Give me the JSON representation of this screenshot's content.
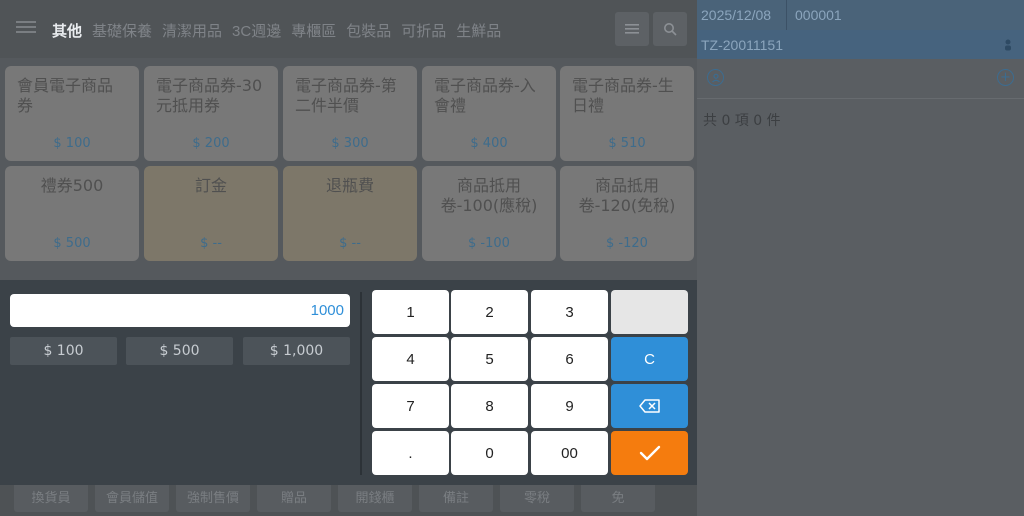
{
  "topbar": {
    "categories": [
      "其他",
      "基礎保養",
      "清潔用品",
      "3C週邊",
      "專櫃區",
      "包裝品",
      "可折品",
      "生鮮品"
    ],
    "active_category": "其他"
  },
  "products": [
    {
      "name": "會員電子商品券",
      "price": "$ 100"
    },
    {
      "name": "電子商品券-30元抵用券",
      "price": "$ 200"
    },
    {
      "name": "電子商品券-第二件半價",
      "price": "$ 300"
    },
    {
      "name": "電子商品券-入會禮",
      "price": "$ 400"
    },
    {
      "name": "電子商品券-生日禮",
      "price": "$ 510"
    },
    {
      "name": "禮券500",
      "price": "$ 500"
    },
    {
      "name": "訂金",
      "price": "$ --"
    },
    {
      "name": "退瓶費",
      "price": "$ --"
    },
    {
      "name": "商品抵用卷-100(應稅)",
      "price": "$ -100"
    },
    {
      "name": "商品抵用卷-120(免稅)",
      "price": "$ -120"
    }
  ],
  "bottombar": {
    "buttons": [
      "換貨員",
      "會員儲值",
      "強制售價",
      "贈品",
      "開錢櫃",
      "備註",
      "零稅",
      "免"
    ]
  },
  "keypad": {
    "amount_value": "1000",
    "presets": [
      "$ 100",
      "$ 500",
      "$ 1,000"
    ],
    "keys": {
      "k1": "1",
      "k2": "2",
      "k3": "3",
      "k4": "4",
      "k5": "5",
      "k6": "6",
      "k7": "7",
      "k8": "8",
      "k9": "9",
      "kdot": ".",
      "k0": "0",
      "k00": "00",
      "clear": "C"
    },
    "colors": {
      "blue": "#2f8fd8",
      "orange": "#f57c0e"
    }
  },
  "order_panel": {
    "date": "2025/12/08",
    "terminal_number": "000001",
    "order_id": "TZ-20011151",
    "summary": "共 0 項 0 件"
  },
  "icons": {
    "menu": "menu-icon",
    "list": "list-icon",
    "search": "search-icon",
    "backspace": "backspace-icon",
    "confirm": "checkmark-icon",
    "member": "member-icon",
    "add": "add-circle-icon",
    "person": "person-icon"
  }
}
